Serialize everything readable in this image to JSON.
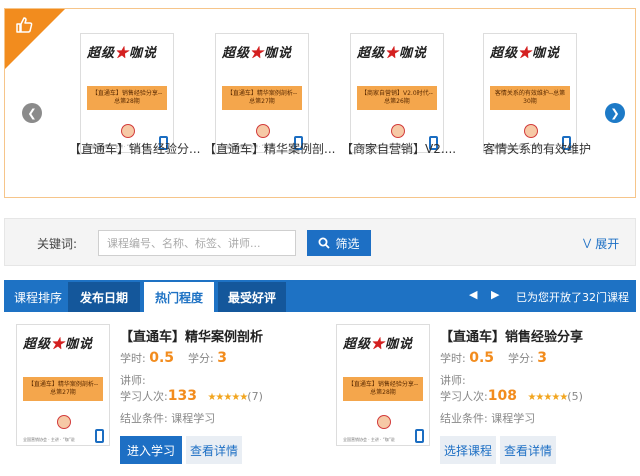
{
  "carousel": {
    "prev_icon": "chevron-left-icon",
    "next_icon": "chevron-right-icon",
    "corner_icon": "thumbs-up-icon",
    "slides": [
      {
        "caption": "【直通车】销售经验分...",
        "cover_text": "【直通车】销售经验分享--总第28期"
      },
      {
        "caption": "【直通车】精华案例剖...",
        "cover_text": "【直通车】精华案例剖析--总第27期"
      },
      {
        "caption": "【商家自营销】V2....",
        "cover_text": "【商家自营销】V2.0时代--总第26期"
      },
      {
        "caption": "客情关系的有效维护",
        "cover_text": "客情关系的有效维护--总第30期"
      }
    ]
  },
  "cover": {
    "logo_left": "超级",
    "logo_star": "★",
    "logo_right": "咖说",
    "footer": "全国营销协会 · 主讲 · “咖”说"
  },
  "filter": {
    "label": "关键词:",
    "placeholder": "课程编号、名称、标签、讲师...",
    "button": "筛选",
    "expand": "展开"
  },
  "sort": {
    "title": "课程排序",
    "tabs": [
      "发布日期",
      "热门程度",
      "最受好评"
    ],
    "status": "已为您开放了32门课程"
  },
  "courses": [
    {
      "title": "【直通车】精华案例剖析",
      "cover_text": "【直通车】精华案例剖析--总第27期",
      "hours_label": "学时:",
      "hours": "0.5",
      "credit_label": "学分:",
      "credit": "3",
      "teacher_label": "讲师:",
      "learners_label": "学习人次:",
      "learners": "133",
      "stars": "★★★★★",
      "rating_count": "(7)",
      "condition": "结业条件: 课程学习",
      "primary_button": "进入学习",
      "secondary_button": "查看详情"
    },
    {
      "title": "【直通车】销售经验分享",
      "cover_text": "【直通车】销售经验分享--总第28期",
      "hours_label": "学时:",
      "hours": "0.5",
      "credit_label": "学分:",
      "credit": "3",
      "teacher_label": "讲师:",
      "learners_label": "学习人次:",
      "learners": "108",
      "stars": "★★★★★",
      "rating_count": "(5)",
      "condition": "结业条件: 课程学习",
      "primary_button": "选择课程",
      "secondary_button": "查看详情"
    }
  ],
  "colors": {
    "accent": "#1d6fc4",
    "highlight": "#f28c1e",
    "border": "#f6c58a"
  }
}
